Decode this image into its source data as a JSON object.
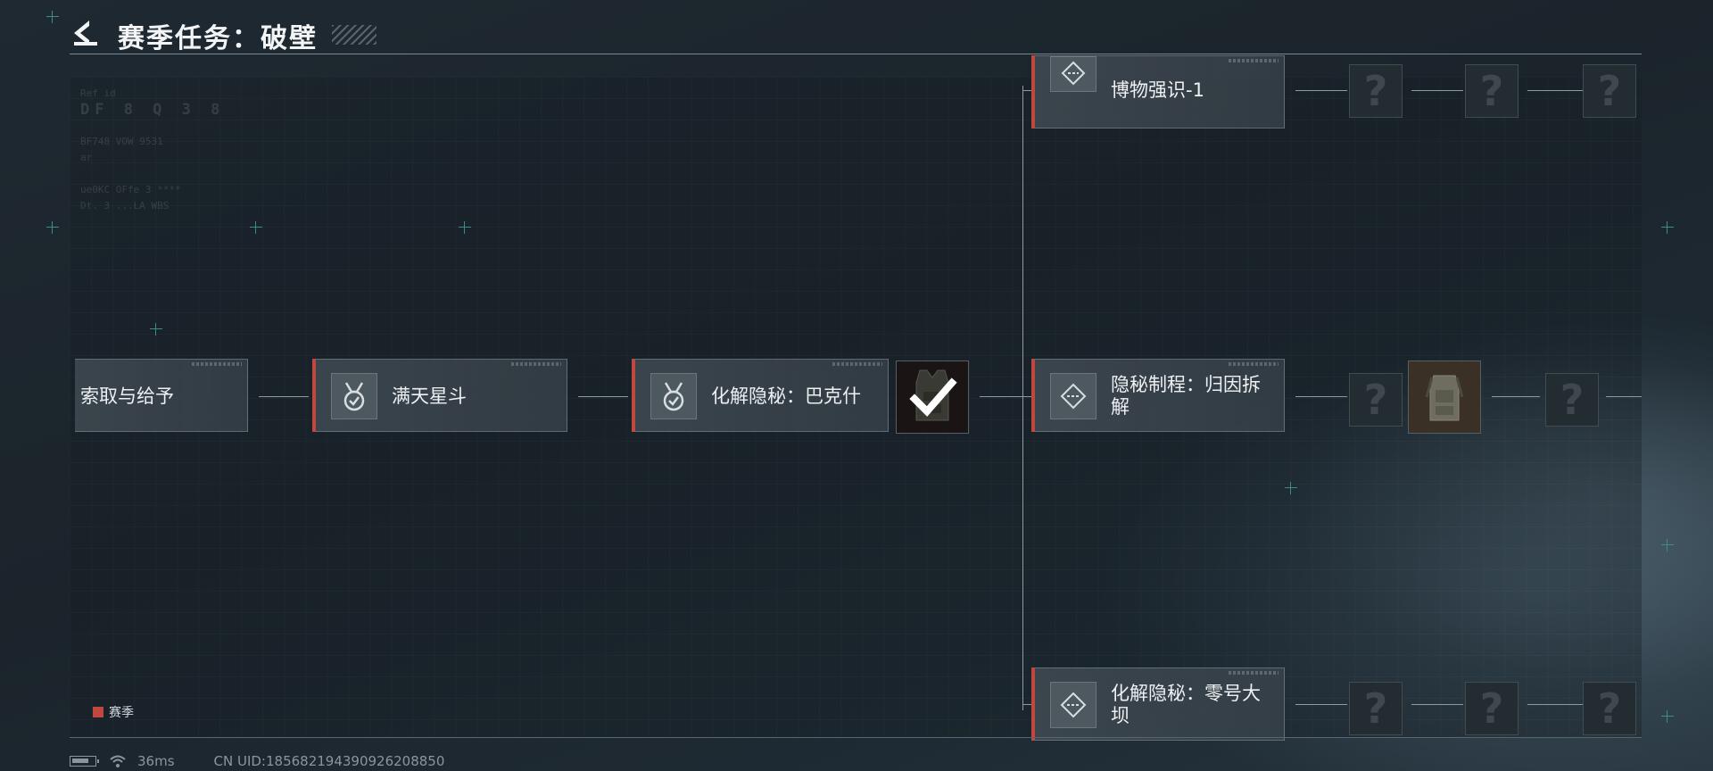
{
  "header": {
    "title": "赛季任务：破壁"
  },
  "decor": {
    "line1": "Ref id",
    "line2": "DF  8  Q  3  8",
    "line3": "BF748 VOW 9531",
    "line4": "ar",
    "line5": "ue0KC OFfe 3 ****",
    "line6": "Dt. 3 ...LA WBS"
  },
  "tasks": [
    {
      "label": "索取与给予",
      "status": "completed"
    },
    {
      "label": "满天星斗",
      "status": "completed"
    },
    {
      "label": "化解隐秘：巴克什",
      "status": "completed"
    },
    {
      "label": "博物强识-1",
      "status": "active"
    },
    {
      "label": "隐秘制程：归因拆解",
      "status": "active"
    },
    {
      "label": "化解隐秘：零号大坝",
      "status": "active"
    }
  ],
  "unknown_mark": "?",
  "legend": {
    "label": "赛季",
    "color": "#c2473f"
  },
  "status_bar": {
    "ping": "36ms",
    "uid": "CN UID:185682194390926208850"
  },
  "colors": {
    "accent": "#c2473f",
    "background": "#1e2830",
    "card": "#464f56"
  },
  "icons": {
    "back": "chevron-left-icon",
    "completed_task": "medal-check-icon",
    "active_task": "diamond-path-icon",
    "checkmark": "checkmark-icon",
    "wifi": "wifi-icon",
    "battery": "battery-icon"
  }
}
